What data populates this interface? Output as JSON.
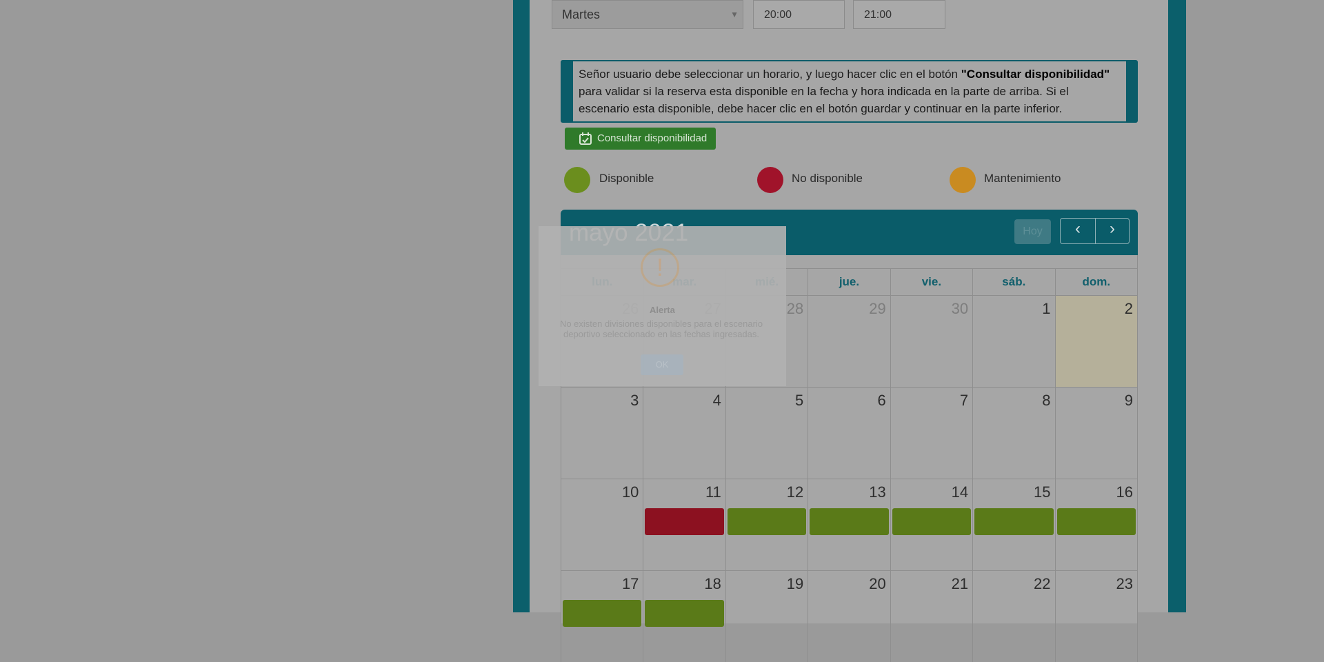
{
  "form": {
    "day_select": "Martes",
    "time_from": "20:00",
    "time_to": "21:00"
  },
  "notice": {
    "text_before": "Señor usuario debe seleccionar un horario, y luego hacer clic en el botón ",
    "text_bold": "\"Consultar disponibilidad\"",
    "text_after": " para validar si la reserva esta disponible en la fecha y hora indicada en la parte de arriba. Si el escenario esta disponible, debe hacer clic en el botón guardar y continuar en la parte inferior."
  },
  "check_button": {
    "label": "Consultar disponibilidad",
    "icon": "calendar-check-icon"
  },
  "legend": [
    {
      "label": "Disponible",
      "color": "#6b8e1e"
    },
    {
      "label": "No disponible",
      "color": "#a0132a"
    },
    {
      "label": "Mantenimiento",
      "color": "#c98b21"
    }
  ],
  "calendar": {
    "title": "mayo 2021",
    "today_button": "Hoy",
    "prev": "‹",
    "next": "›",
    "weekdays": [
      "lun.",
      "mar.",
      "mié.",
      "jue.",
      "vie.",
      "sáb.",
      "dom."
    ],
    "weeks": [
      [
        {
          "day": "26",
          "other": true
        },
        {
          "day": "27",
          "other": true
        },
        {
          "day": "28",
          "other": true
        },
        {
          "day": "29",
          "other": true
        },
        {
          "day": "30",
          "other": true
        },
        {
          "day": "1"
        },
        {
          "day": "2",
          "today": true
        }
      ],
      [
        {
          "day": "3"
        },
        {
          "day": "4"
        },
        {
          "day": "5"
        },
        {
          "day": "6"
        },
        {
          "day": "7"
        },
        {
          "day": "8"
        },
        {
          "day": "9"
        }
      ],
      [
        {
          "day": "10"
        },
        {
          "day": "11",
          "event": "red"
        },
        {
          "day": "12",
          "event": "green"
        },
        {
          "day": "13",
          "event": "green"
        },
        {
          "day": "14",
          "event": "green"
        },
        {
          "day": "15",
          "event": "green"
        },
        {
          "day": "16",
          "event": "green"
        }
      ],
      [
        {
          "day": "17",
          "event": "green"
        },
        {
          "day": "18",
          "event": "green"
        },
        {
          "day": "19"
        },
        {
          "day": "20"
        },
        {
          "day": "21"
        },
        {
          "day": "22"
        },
        {
          "day": "23"
        }
      ]
    ]
  },
  "alert": {
    "icon": "warning-icon",
    "title": "Alerta",
    "message": "No existen divisiones disponibles para el escenario deportivo seleccionado en las fechas ingresadas.",
    "ok_label": "OK"
  }
}
